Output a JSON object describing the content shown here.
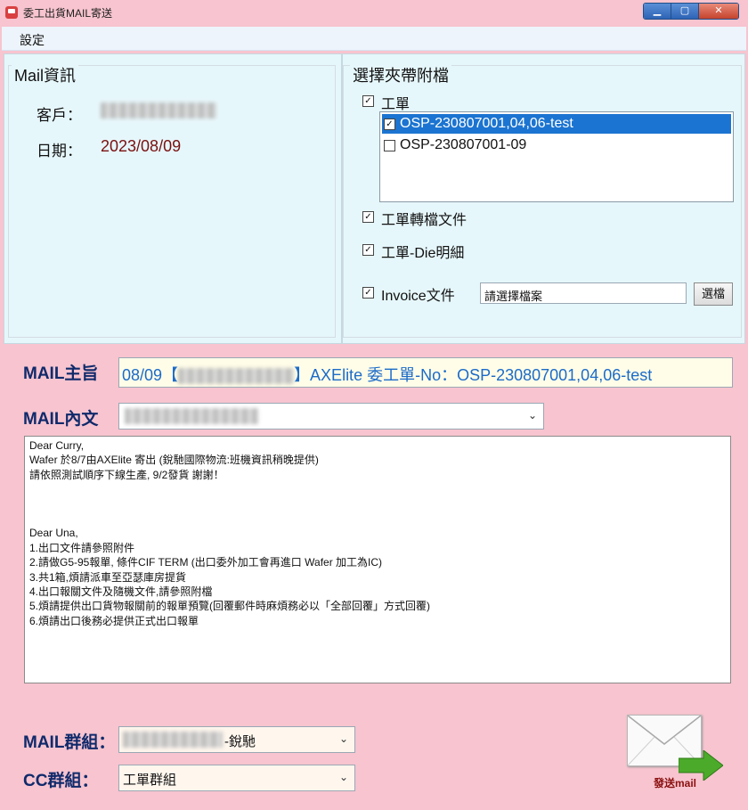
{
  "window": {
    "title": "委工出貨MAIL寄送",
    "minimize": "▁",
    "maximize": "▢",
    "close": "✕"
  },
  "menu": {
    "settings": "設定"
  },
  "mail_info": {
    "legend": "Mail資訊",
    "customer_label": "客戶：",
    "date_label": "日期：",
    "date_value": "2023/08/09"
  },
  "attachments": {
    "legend": "選擇夾帶附檔",
    "work_order": {
      "label": "工單",
      "checked": true
    },
    "work_order_items": [
      {
        "label": "OSP-230807001,04,06-test",
        "checked": true,
        "selected": true
      },
      {
        "label": "OSP-230807001-09",
        "checked": false,
        "selected": false
      }
    ],
    "conversion_docs": {
      "label": "工單轉檔文件",
      "checked": true
    },
    "die_details": {
      "label": "工單-Die明細",
      "checked": true
    },
    "invoice": {
      "label": "Invoice文件",
      "checked": true,
      "file_value": "請選擇檔案",
      "browse_label": "選檔"
    }
  },
  "mail": {
    "subject_label": "MAIL主旨",
    "subject_prefix": "08/09【",
    "subject_suffix": "】AXElite 委工單-No：OSP-230807001,04,06-test",
    "body_label": "MAIL內文",
    "body_text": "Dear Curry,\nWafer 於8/7由AXElite 寄出 (銳馳國際物流:班機資訊稍晚提供)\n請依照測試順序下線生產, 9/2發貨 謝謝！\n\n\n\nDear Una,\n1.出口文件請參照附件\n2.請做G5-95報單, 條件CIF TERM (出口委外加工會再進口 Wafer 加工為IC)\n3.共1箱,煩請派車至亞瑟庫房提貨\n4.出口報關文件及隨機文件,請參照附檔\n5.煩請提供出口貨物報關前的報單預覽(回覆郵件時麻煩務必以「全部回覆」方式回覆)\n6.煩請出口後務必提供正式出口報單",
    "group_label": "MAIL群組：",
    "group_value_suffix": "-銳馳",
    "cc_label": "CC群組：",
    "cc_value": "工單群組",
    "send_label": "發送mail"
  },
  "icons": {
    "checkmark": "✓",
    "dropdown": "⌄"
  }
}
